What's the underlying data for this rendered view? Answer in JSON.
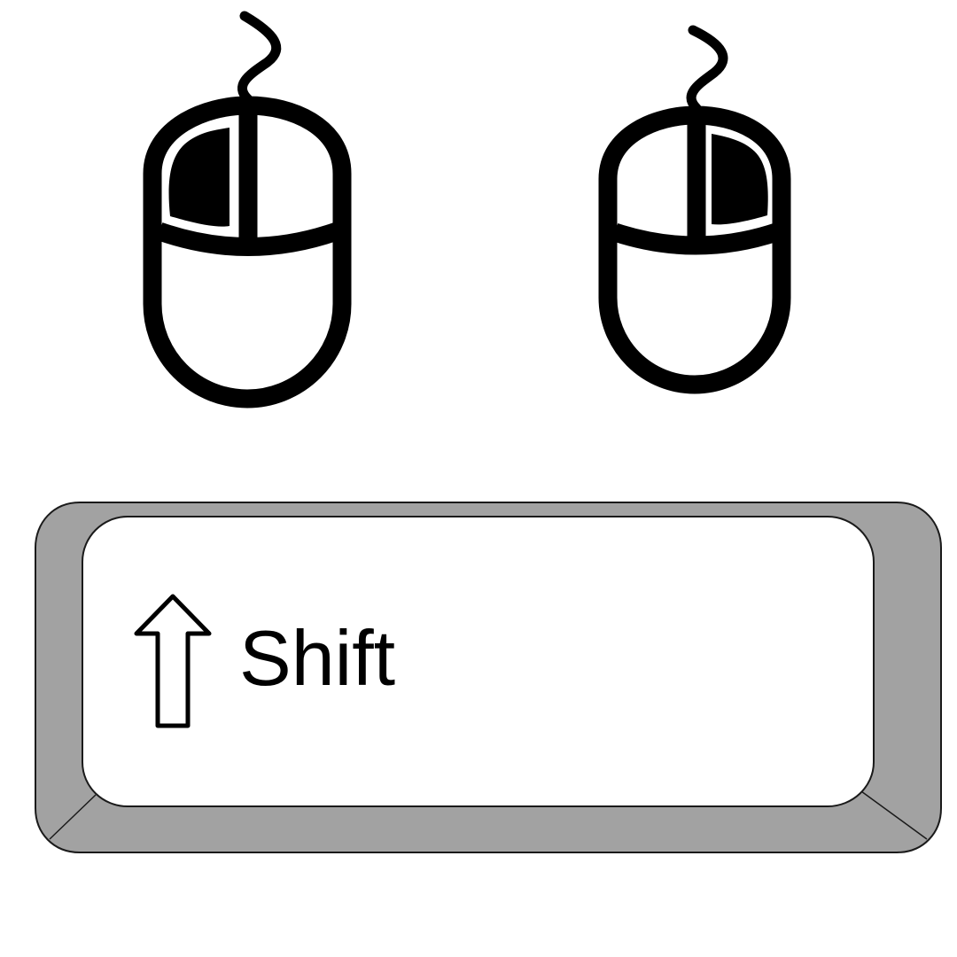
{
  "mice": [
    {
      "name": "mouse-left",
      "pressed_button": "left"
    },
    {
      "name": "mouse-right",
      "pressed_button": "right"
    }
  ],
  "key": {
    "label": "Shift",
    "icon": "shift-arrow-icon"
  },
  "colors": {
    "background": "#ffffff",
    "ink": "#000000",
    "key_bezel": "#a2a2a2",
    "key_face": "#ffffff"
  }
}
